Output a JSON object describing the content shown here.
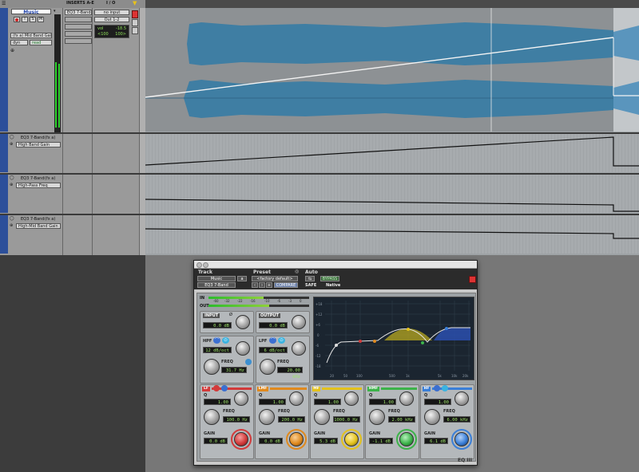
{
  "track": {
    "name": "Music",
    "plugin_slot": "(fx a) Mid Band Gain",
    "dyn_label": "dyn",
    "auto_mode": "read"
  },
  "columns": {
    "inserts": "INSERTS A-E",
    "io": "I / O"
  },
  "insert_slot_1": "EQ3 7-Band",
  "io": {
    "input": "no input",
    "output": "Out 1-2",
    "vol_label": "vol",
    "vol_value": "-18.5",
    "pan_left": "<100",
    "pan_right": "100>"
  },
  "lanes": [
    {
      "plugin": "EQ3 7-Band",
      "tag": "(fx a)",
      "param": "High Band Gain"
    },
    {
      "plugin": "EQ3 7-Band",
      "tag": "(fx a)",
      "param": "High-Pass Freq"
    },
    {
      "plugin": "EQ3 7-Band",
      "tag": "(fx a)",
      "param": "High-Mid Band Gain"
    }
  ],
  "plugin": {
    "track_label": "Track",
    "preset_label": "Preset",
    "auto_label": "Auto",
    "track_name": "Music",
    "track_suffix": "a",
    "insert_name": "EQ3 7-Band",
    "preset_name": "<factory default>",
    "compare": "COMPARE",
    "bypass": "BYPASS",
    "safe": "SAFE",
    "native": "Native",
    "logo": "EQ III",
    "meter_in": "IN",
    "meter_out": "OUT",
    "meter_scale": [
      "-60",
      "-32",
      "-22",
      "-16",
      "-10",
      "-6",
      "-3",
      "0"
    ],
    "input_label": "INPUT",
    "input_value": "0.0 dB",
    "output_label": "OUTPUT",
    "output_value": "0.0 dB",
    "hpf": {
      "label": "HPF",
      "slope": "12 dB/oct",
      "freq_label": "FREQ",
      "freq": "31.7 Hz"
    },
    "lpf": {
      "label": "LPF",
      "slope": "6 dB/oct",
      "freq_label": "FREQ",
      "freq": "20.00 kHz"
    },
    "bands": [
      {
        "tag": "LF",
        "color": "#d23a3a",
        "q_label": "Q",
        "q": "1.00",
        "freq_label": "FREQ",
        "freq": "100.0 Hz",
        "gain_label": "GAIN",
        "gain": "0.0 dB"
      },
      {
        "tag": "LMF",
        "color": "#e08a1e",
        "q_label": "Q",
        "q": "1.00",
        "freq_label": "FREQ",
        "freq": "200.0 Hz",
        "gain_label": "GAIN",
        "gain": "0.0 dB"
      },
      {
        "tag": "MF",
        "color": "#e4c21c",
        "q_label": "Q",
        "q": "1.00",
        "freq_label": "FREQ",
        "freq": "1000.0 Hz",
        "gain_label": "GAIN",
        "gain": "5.3 dB"
      },
      {
        "tag": "HMF",
        "color": "#3db34a",
        "q_label": "Q",
        "q": "1.00",
        "freq_label": "FREQ",
        "freq": "2.00 kHz",
        "gain_label": "GAIN",
        "gain": "-1.1 dB"
      },
      {
        "tag": "HF",
        "color": "#3a7fd8",
        "q_label": "Q",
        "q": "1.00",
        "freq_label": "FREQ",
        "freq": "6.00 kHz",
        "gain_label": "GAIN",
        "gain": "6.1 dB"
      }
    ],
    "graph_y": [
      "+18",
      "+12",
      "+6",
      "0",
      "-6",
      "-12",
      "-18"
    ],
    "graph_x": [
      "20",
      "50",
      "100",
      "500",
      "1k",
      "5k",
      "10k",
      "20k"
    ]
  }
}
